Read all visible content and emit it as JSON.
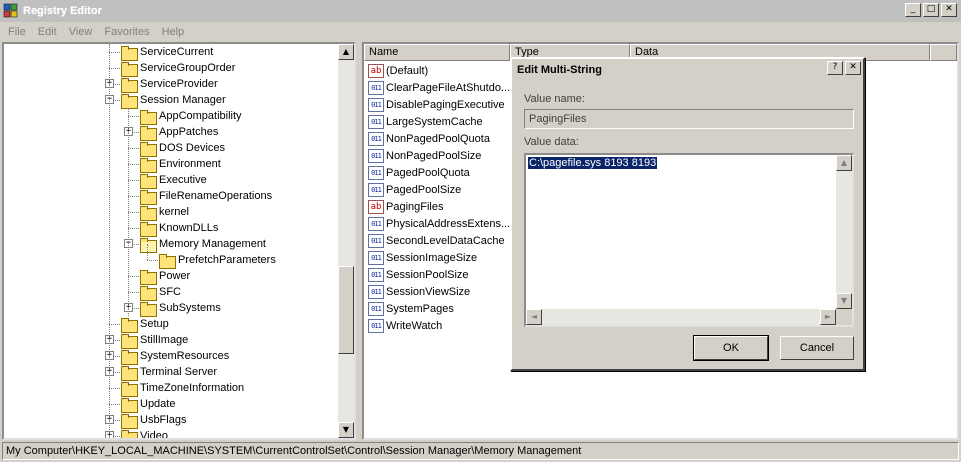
{
  "window": {
    "title": "Registry Editor"
  },
  "window_buttons": {
    "minimize": "_",
    "maximize": "□",
    "close": "✕"
  },
  "menu": [
    "File",
    "Edit",
    "View",
    "Favorites",
    "Help"
  ],
  "tree": {
    "items": [
      {
        "label": "ServiceCurrent",
        "level": 0,
        "expander": ""
      },
      {
        "label": "ServiceGroupOrder",
        "level": 0,
        "expander": ""
      },
      {
        "label": "ServiceProvider",
        "level": 0,
        "expander": "+"
      },
      {
        "label": "Session Manager",
        "level": 0,
        "expander": "−"
      },
      {
        "label": "AppCompatibility",
        "level": 1,
        "expander": ""
      },
      {
        "label": "AppPatches",
        "level": 1,
        "expander": "+"
      },
      {
        "label": "DOS Devices",
        "level": 1,
        "expander": ""
      },
      {
        "label": "Environment",
        "level": 1,
        "expander": ""
      },
      {
        "label": "Executive",
        "level": 1,
        "expander": ""
      },
      {
        "label": "FileRenameOperations",
        "level": 1,
        "expander": ""
      },
      {
        "label": "kernel",
        "level": 1,
        "expander": ""
      },
      {
        "label": "KnownDLLs",
        "level": 1,
        "expander": ""
      },
      {
        "label": "Memory Management",
        "level": 1,
        "expander": "−",
        "open": true
      },
      {
        "label": "PrefetchParameters",
        "level": 2,
        "expander": ""
      },
      {
        "label": "Power",
        "level": 1,
        "expander": ""
      },
      {
        "label": "SFC",
        "level": 1,
        "expander": ""
      },
      {
        "label": "SubSystems",
        "level": 1,
        "expander": "+"
      },
      {
        "label": "Setup",
        "level": 0,
        "expander": ""
      },
      {
        "label": "StillImage",
        "level": 0,
        "expander": "+"
      },
      {
        "label": "SystemResources",
        "level": 0,
        "expander": "+"
      },
      {
        "label": "Terminal Server",
        "level": 0,
        "expander": "+"
      },
      {
        "label": "TimeZoneInformation",
        "level": 0,
        "expander": ""
      },
      {
        "label": "Update",
        "level": 0,
        "expander": ""
      },
      {
        "label": "UsbFlags",
        "level": 0,
        "expander": "+"
      },
      {
        "label": "Video",
        "level": 0,
        "expander": "+"
      }
    ]
  },
  "list": {
    "columns": [
      "Name",
      "Type",
      "Data"
    ],
    "items": [
      {
        "name": "(Default)",
        "icon": "string-value-icon",
        "glyph": "ab"
      },
      {
        "name": "ClearPageFileAtShutdo...",
        "icon": "binary-value-icon",
        "glyph": "011"
      },
      {
        "name": "DisablePagingExecutive",
        "icon": "binary-value-icon",
        "glyph": "011"
      },
      {
        "name": "LargeSystemCache",
        "icon": "binary-value-icon",
        "glyph": "011"
      },
      {
        "name": "NonPagedPoolQuota",
        "icon": "binary-value-icon",
        "glyph": "011"
      },
      {
        "name": "NonPagedPoolSize",
        "icon": "binary-value-icon",
        "glyph": "011"
      },
      {
        "name": "PagedPoolQuota",
        "icon": "binary-value-icon",
        "glyph": "011"
      },
      {
        "name": "PagedPoolSize",
        "icon": "binary-value-icon",
        "glyph": "011"
      },
      {
        "name": "PagingFiles",
        "icon": "string-value-icon",
        "glyph": "ab"
      },
      {
        "name": "PhysicalAddressExtens...",
        "icon": "binary-value-icon",
        "glyph": "011"
      },
      {
        "name": "SecondLevelDataCache",
        "icon": "binary-value-icon",
        "glyph": "011"
      },
      {
        "name": "SessionImageSize",
        "icon": "binary-value-icon",
        "glyph": "011"
      },
      {
        "name": "SessionPoolSize",
        "icon": "binary-value-icon",
        "glyph": "011"
      },
      {
        "name": "SessionViewSize",
        "icon": "binary-value-icon",
        "glyph": "011"
      },
      {
        "name": "SystemPages",
        "icon": "binary-value-icon",
        "glyph": "011"
      },
      {
        "name": "WriteWatch",
        "icon": "binary-value-icon",
        "glyph": "011"
      }
    ]
  },
  "statusbar": {
    "path": "My Computer\\HKEY_LOCAL_MACHINE\\SYSTEM\\CurrentControlSet\\Control\\Session Manager\\Memory Management"
  },
  "dialog": {
    "title": "Edit Multi-String",
    "help_label": "?",
    "close_label": "✕",
    "value_name_label": "Value name:",
    "value_name": "PagingFiles",
    "value_data_label": "Value data:",
    "value_data": "C:\\pagefile.sys 8193 8193",
    "ok_label": "OK",
    "cancel_label": "Cancel"
  },
  "scroll": {
    "up": "▲",
    "down": "▼",
    "left": "◄",
    "right": "►"
  },
  "colors": {
    "selection": "#0a246a",
    "folder": "#ffe27a",
    "chrome": "#d4d0c8"
  }
}
